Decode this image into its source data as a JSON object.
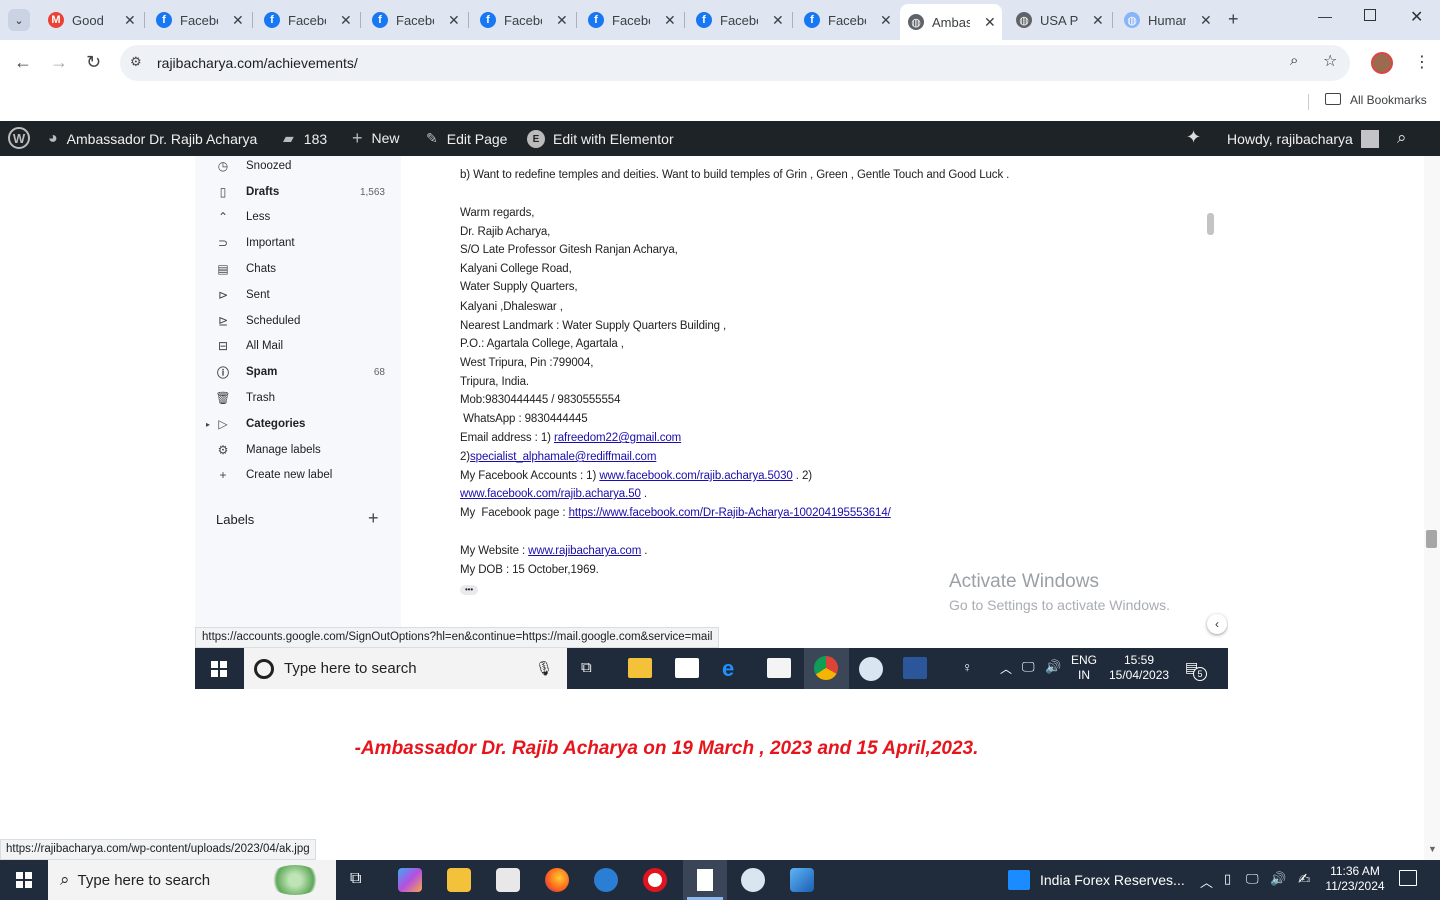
{
  "tabs": [
    {
      "title": "Good",
      "favicon": "gmail-icon",
      "color": "#ea4335",
      "glyph": "M"
    },
    {
      "title": "Facebo",
      "favicon": "facebook-icon",
      "color": "#1877f2",
      "glyph": "f"
    },
    {
      "title": "Facebo",
      "favicon": "facebook-icon",
      "color": "#1877f2",
      "glyph": "f"
    },
    {
      "title": "Facebo",
      "favicon": "facebook-icon",
      "color": "#1877f2",
      "glyph": "f"
    },
    {
      "title": "Facebo",
      "favicon": "facebook-icon",
      "color": "#1877f2",
      "glyph": "f"
    },
    {
      "title": "Facebo",
      "favicon": "facebook-icon",
      "color": "#1877f2",
      "glyph": "f"
    },
    {
      "title": "Facebo",
      "favicon": "facebook-icon",
      "color": "#1877f2",
      "glyph": "f"
    },
    {
      "title": "Facebo",
      "favicon": "facebook-icon",
      "color": "#1877f2",
      "glyph": "f"
    },
    {
      "title": "Ambas",
      "favicon": "globe-icon",
      "color": "#5f6368",
      "glyph": "◍",
      "active": true
    },
    {
      "title": "USA Pr",
      "favicon": "globe-icon",
      "color": "#5f6368",
      "glyph": "◍"
    },
    {
      "title": "Human",
      "favicon": "globe-icon",
      "color": "#8ab4f8",
      "glyph": "◍"
    }
  ],
  "toolbar": {
    "url": "rajibacharya.com/achievements/",
    "all_bookmarks": "All Bookmarks"
  },
  "wpbar": {
    "site_name": "Ambassador Dr. Rajib Acharya",
    "comments_count": "183",
    "new_label": "New",
    "edit_page": "Edit Page",
    "edit_elementor": "Edit with Elementor",
    "howdy": "Howdy, rajibacharya"
  },
  "gmail_sidebar": {
    "items": [
      {
        "label": "Snoozed",
        "icon": "clock-icon",
        "glyph": "◷",
        "bold": false,
        "count": ""
      },
      {
        "label": "Drafts",
        "icon": "draft-icon",
        "glyph": "▯",
        "bold": true,
        "count": "1,563"
      },
      {
        "label": "Less",
        "icon": "chevron-up-icon",
        "glyph": "⌃",
        "bold": false,
        "count": ""
      },
      {
        "label": "Important",
        "icon": "important-icon",
        "glyph": "⊃",
        "bold": false,
        "count": ""
      },
      {
        "label": "Chats",
        "icon": "chat-icon",
        "glyph": "▤",
        "bold": false,
        "count": ""
      },
      {
        "label": "Sent",
        "icon": "send-icon",
        "glyph": "⊳",
        "bold": false,
        "count": ""
      },
      {
        "label": "Scheduled",
        "icon": "scheduled-icon",
        "glyph": "⊵",
        "bold": false,
        "count": ""
      },
      {
        "label": "All Mail",
        "icon": "all-mail-icon",
        "glyph": "⊟",
        "bold": false,
        "count": ""
      },
      {
        "label": "Spam",
        "icon": "spam-icon",
        "glyph": "ⓘ",
        "bold": true,
        "count": "68"
      },
      {
        "label": "Trash",
        "icon": "trash-icon",
        "glyph": "🗑",
        "bold": false,
        "count": ""
      },
      {
        "label": "Categories",
        "icon": "label-icon",
        "glyph": "▷",
        "bold": true,
        "count": ""
      },
      {
        "label": "Manage labels",
        "icon": "gear-icon",
        "glyph": "⚙",
        "bold": false,
        "count": ""
      },
      {
        "label": "Create new label",
        "icon": "plus-icon",
        "glyph": "+",
        "bold": false,
        "count": ""
      }
    ],
    "labels_heading": "Labels"
  },
  "email": {
    "line_b": "b) Want to redefine temples and deities. Want to build temples of Grin , Green , Gentle Touch and Good Luck .",
    "regards": "Warm regards,",
    "name": "Dr. Rajib Acharya,",
    "so": "S/O Late Professor Gitesh Ranjan Acharya,",
    "addr1": "Kalyani College Road,",
    "addr2": "Water Supply Quarters,",
    "addr3": "Kalyani ,Dhaleswar ,",
    "landmark": "Nearest Landmark : Water Supply Quarters Building ,",
    "po": "P.O.: Agartala College, Agartala ,",
    "pin": "West Tripura, Pin :799004,",
    "country": "Tripura, India.",
    "mob": "Mob:9830444445 / 9830555554",
    "whatsapp": " WhatsApp : 9830444445",
    "email_prefix": "Email address : 1) ",
    "email1": "rafreedom22@gmail.com",
    "email2_prefix": "2)",
    "email2": "specialist_alphamale@rediffmail.com",
    "fb_prefix": "My Facebook Accounts : 1) ",
    "fb1": "www.facebook.com/rajib.acharya.5030",
    "fb1_suffix": " . 2)",
    "fb2": "www.facebook.com/rajib.acharya.50",
    "fb2_suffix": " .",
    "fbpage_prefix": "My  Facebook page : ",
    "fbpage": "https://www.facebook.com/Dr-Rajib-Acharya-100204195553614/",
    "website_prefix": "My Website : ",
    "website": "www.rajibacharya.com",
    "website_suffix": " .",
    "dob": "My DOB : 15 October,1969.",
    "more": "•••"
  },
  "watermark": {
    "title": "Activate Windows",
    "subtitle": "Go to Settings to activate Windows."
  },
  "inner_status_url": "https://accounts.google.com/SignOutOptions?hl=en&continue=https://mail.google.com&service=mail",
  "inner_taskbar": {
    "search_placeholder": "Type here to search",
    "lang1": "ENG",
    "lang2": "IN",
    "time": "15:59",
    "date": "15/04/2023",
    "notif_count": "5"
  },
  "caption": "-Ambassador Dr. Rajib Acharya on 19 March , 2023 and 15 April,2023.",
  "outer_status_url": "https://rajibacharya.com/wp-content/uploads/2023/04/ak.jpg",
  "taskbar": {
    "search_placeholder": "Type here to search",
    "news": "India Forex Reserves...",
    "time": "11:36 AM",
    "date": "11/23/2024"
  }
}
